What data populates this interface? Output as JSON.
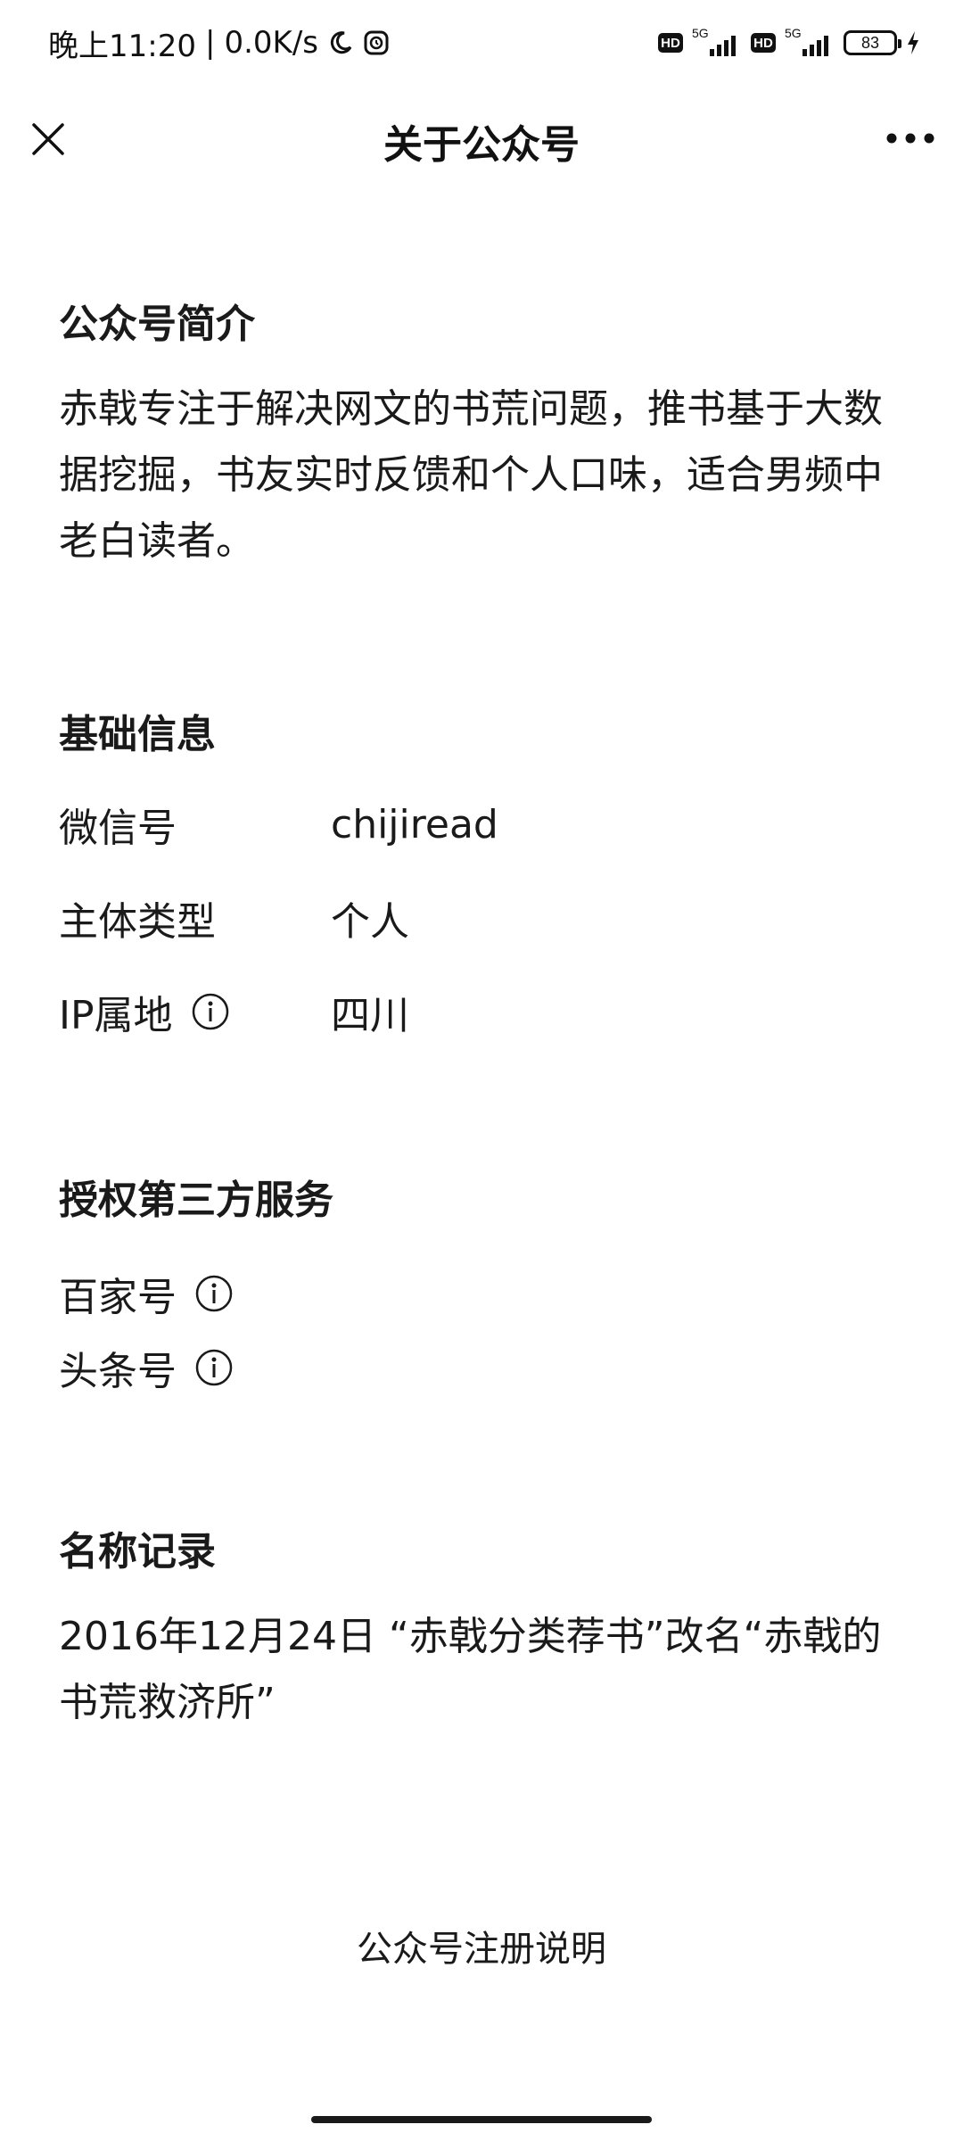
{
  "status_bar": {
    "time": "晚上11:20",
    "separator": "|",
    "net_speed": "0.0K/s",
    "network_1": "5G",
    "network_2": "5G",
    "hd_1": "HD",
    "hd_2": "HD",
    "battery": "83",
    "icons": [
      "moon-icon",
      "alarm-icon",
      "hd-icon",
      "signal-icon",
      "battery-icon",
      "charging-icon"
    ]
  },
  "header": {
    "title": "关于公众号",
    "close_icon": "close-icon",
    "more_icon": "more-icon"
  },
  "intro": {
    "heading": "公众号简介",
    "text": "赤戟专注于解决网文的书荒问题，推书基于大数据挖掘，书友实时反馈和个人口味，适合男频中老白读者。"
  },
  "basic_info": {
    "heading": "基础信息",
    "rows": [
      {
        "label": "微信号",
        "value": "chijiread"
      },
      {
        "label": "主体类型",
        "value": "个人"
      },
      {
        "label": "IP属地",
        "value": "四川",
        "has_info_icon": true
      }
    ]
  },
  "third_party": {
    "heading": "授权第三方服务",
    "items": [
      {
        "label": "百家号"
      },
      {
        "label": "头条号"
      }
    ]
  },
  "name_record": {
    "heading": "名称记录",
    "text": "2016年12月24日 “赤戟分类荐书”改名“赤戟的书荒救济所”"
  },
  "footer": {
    "register_link": "公众号注册说明"
  },
  "colors": {
    "text": "#1a1a1a",
    "background": "#ffffff"
  }
}
